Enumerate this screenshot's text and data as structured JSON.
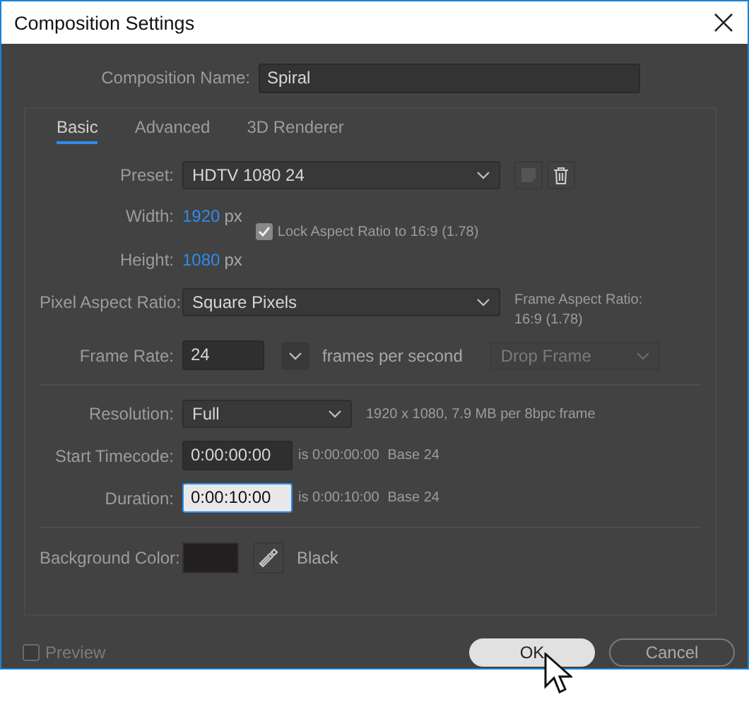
{
  "window": {
    "title": "Composition Settings"
  },
  "composition_name": {
    "label": "Composition Name:",
    "value": "Spiral"
  },
  "tabs": [
    {
      "label": "Basic",
      "selected": true
    },
    {
      "label": "Advanced",
      "selected": false
    },
    {
      "label": "3D Renderer",
      "selected": false
    }
  ],
  "preset": {
    "label": "Preset:",
    "value": "HDTV 1080 24"
  },
  "width": {
    "label": "Width:",
    "value": "1920",
    "unit": "px"
  },
  "height": {
    "label": "Height:",
    "value": "1080",
    "unit": "px"
  },
  "lock_aspect": {
    "label": "Lock Aspect Ratio to 16:9 (1.78)",
    "checked": true
  },
  "pixel_aspect_ratio": {
    "label": "Pixel Aspect Ratio:",
    "value": "Square Pixels"
  },
  "frame_aspect_ratio": {
    "label": "Frame Aspect Ratio:",
    "value": "16:9 (1.78)"
  },
  "frame_rate": {
    "label": "Frame Rate:",
    "value": "24",
    "unit": "frames per second"
  },
  "drop_frame": {
    "value": "Drop Frame",
    "disabled": true
  },
  "resolution": {
    "label": "Resolution:",
    "value": "Full",
    "info": "1920 x 1080, 7.9 MB per 8bpc frame"
  },
  "timecodes": [
    {
      "label": "Start Timecode:",
      "value": "0:00:00:00",
      "info": "is 0:00:00:00",
      "base": "Base 24",
      "focused": false
    },
    {
      "label": "Duration:",
      "value": "0:00:10:00",
      "info": "is 0:00:10:00",
      "base": "Base 24",
      "focused": true
    }
  ],
  "background_color": {
    "label": "Background Color:",
    "color": "#231f20",
    "name": "Black"
  },
  "preview": {
    "label": "Preview",
    "checked": false,
    "disabled": true
  },
  "buttons": [
    {
      "label": "OK",
      "kind": "primary"
    },
    {
      "label": "Cancel",
      "kind": "secondary"
    }
  ]
}
